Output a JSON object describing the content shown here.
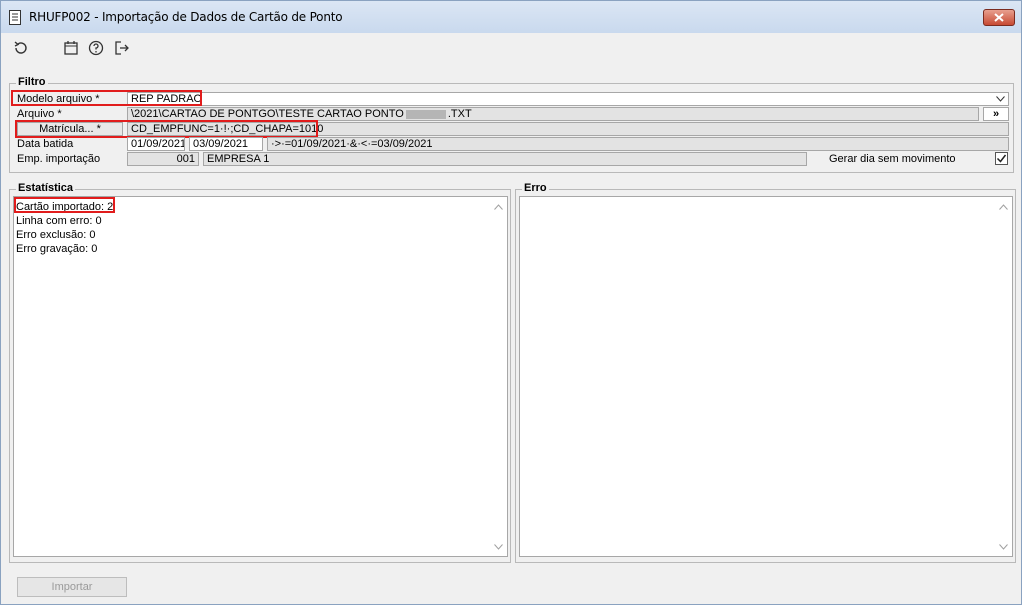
{
  "window": {
    "title": "RHUFP002 - Importação de Dados de Cartão de Ponto"
  },
  "toolbar": {
    "icons": [
      "refresh-icon",
      "calendar-icon",
      "help-icon",
      "exit-icon"
    ]
  },
  "filtro": {
    "title": "Filtro",
    "modelo_label": "Modelo arquivo *",
    "modelo_value": "REP PADRAO",
    "arquivo_label": "Arquivo *",
    "arquivo_value": "\\2021\\CARTAO DE PONTGO\\TESTE CARTAO PONTO",
    "arquivo_ext": ".TXT",
    "arquivo_button": "»",
    "matricula_button": "Matrícula... *",
    "matricula_value": "CD_EMPFUNC=1·!·;CD_CHAPA=1010",
    "data_label": "Data batida",
    "data_inicio": "01/09/2021",
    "data_fim": "03/09/2021",
    "data_expr": "·>·=01/09/2021·&·<·=03/09/2021",
    "emp_label": "Emp. importação",
    "emp_code": "001",
    "emp_name": "EMPRESA 1",
    "gerar_label": "Gerar dia sem movimento",
    "gerar_checked": true
  },
  "estatistica": {
    "title": "Estatística",
    "lines": [
      "Cartão importado: 2",
      "Linha com erro: 0",
      "Erro exclusão: 0",
      "Erro gravação: 0"
    ]
  },
  "erro": {
    "title": "Erro"
  },
  "actions": {
    "import_label": "Importar"
  },
  "colors": {
    "highlight": "#e11c1c",
    "titlebar": "#c9d9ee"
  }
}
